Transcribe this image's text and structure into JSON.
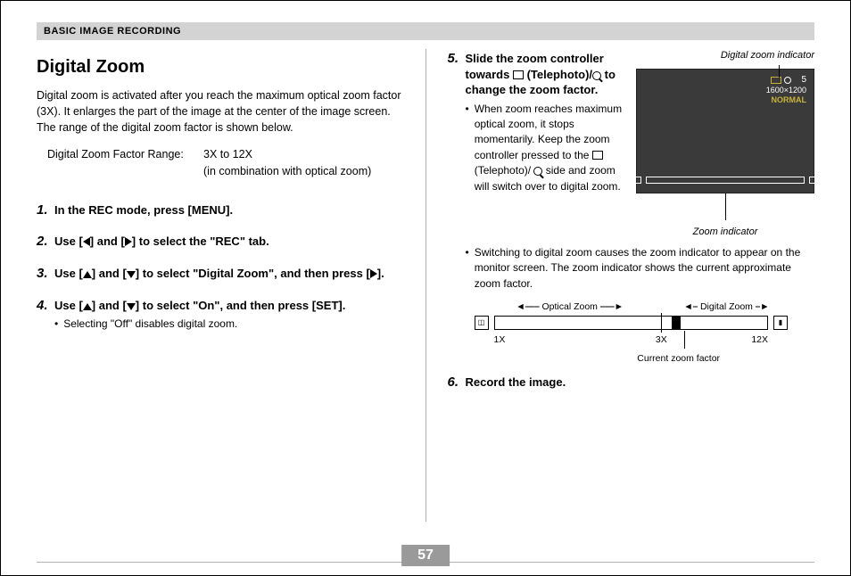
{
  "header": {
    "section": "BASIC IMAGE RECORDING"
  },
  "title": "Digital Zoom",
  "intro": "Digital zoom is activated after you reach the maximum optical zoom factor (3X). It enlarges the part of the image at the center of the image screen. The range of the digital zoom factor is shown below.",
  "factor": {
    "label": "Digital Zoom Factor Range:",
    "value1": "3X to 12X",
    "value2": "(in combination with optical zoom)"
  },
  "steps": [
    {
      "n": "1.",
      "text": "In the REC mode, press [MENU]."
    },
    {
      "n": "2.",
      "text_pre": "Use [",
      "text_mid": "] and [",
      "text_post": "] to select the \"REC\" tab."
    },
    {
      "n": "3.",
      "text_pre": "Use [",
      "text_mid": "] and [",
      "text_mid2": "] to select \"Digital Zoom\", and then press [",
      "text_post": "]."
    },
    {
      "n": "4.",
      "text_pre": "Use [",
      "text_mid": "] and [",
      "text_post": "] to select \"On\", and then press [SET].",
      "sub": "Selecting \"Off\" disables digital zoom."
    }
  ],
  "step5": {
    "n": "5.",
    "line1": "Slide the zoom controller towards ",
    "line2": "(Telephoto)/",
    "line3": " to change the zoom factor.",
    "sub1_a": "When zoom reaches maximum optical zoom, it stops momentarily. Keep the zoom controller pressed to the ",
    "sub1_b": " (Telephoto)/ ",
    "sub1_c": " side and zoom will switch over to digital zoom.",
    "sub2": "Switching to digital zoom causes the zoom indicator to appear on the monitor screen. The zoom indicator shows the current approximate zoom factor."
  },
  "step6": {
    "n": "6.",
    "text": "Record the image."
  },
  "figure": {
    "top_label": "Digital zoom indicator",
    "bottom_label": "Zoom indicator",
    "screen": {
      "count": "5",
      "res": "1600×1200",
      "quality": "NORMAL"
    }
  },
  "diagram": {
    "optical": "Optical Zoom",
    "digital": "Digital Zoom",
    "t1": "1X",
    "t3": "3X",
    "t12": "12X",
    "current": "Current zoom factor"
  },
  "page_number": "57"
}
